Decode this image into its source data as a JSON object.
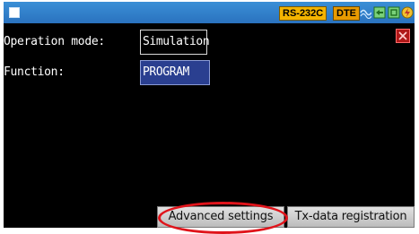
{
  "status_bar": {
    "menu_icon": "square-menu-icon",
    "interface_badge": "RS-232C",
    "role_badge": "DTE",
    "icons": [
      "signal-waves-icon",
      "sd-card-icon",
      "memory-icon",
      "power-icon"
    ]
  },
  "form": {
    "operation_mode": {
      "label": "Operation mode:",
      "value": "Simulation"
    },
    "function": {
      "label": "Function:",
      "value": "PROGRAM"
    }
  },
  "close_icon": "close-x-icon",
  "buttons": {
    "advanced": "Advanced settings",
    "tx_data": "Tx-data registration"
  },
  "colors": {
    "status_bar": "#2a72bf",
    "selected_field": "#2a3f90",
    "highlight_ring": "#e0141b"
  }
}
